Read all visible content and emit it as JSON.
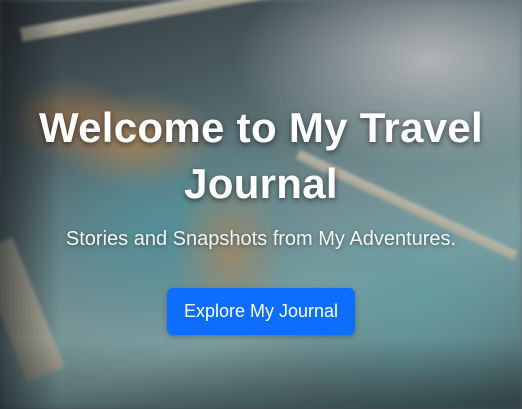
{
  "hero": {
    "title": "Welcome to My Travel Journal",
    "subtitle": "Stories and Snapshots from My Adventures.",
    "cta_label": "Explore My Journal"
  },
  "colors": {
    "accent": "#0d6efd",
    "text": "#ffffff"
  }
}
